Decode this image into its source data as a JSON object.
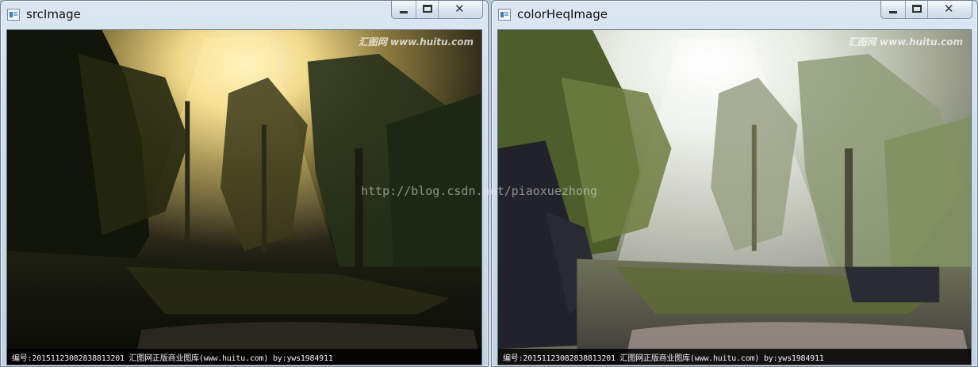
{
  "windows": [
    {
      "title": "srcImage",
      "watermark_top": "汇图网 www.huitu.com",
      "caption": "编号:20151123082838813201  汇图网正版商业图库(www.huitu.com) by:yws1984911"
    },
    {
      "title": "colorHeqImage",
      "watermark_top": "汇图网 www.huitu.com",
      "caption": "编号:20151123082838813201  汇图网正版商业图库(www.huitu.com) by:yws1984911"
    }
  ],
  "overlay_watermark": "http://blog.csdn.net/piaoxuezhong",
  "icons": {
    "app": "opencv-window-icon",
    "minimize": "minimize-icon",
    "maximize": "maximize-icon",
    "close": "close-icon"
  },
  "colors": {
    "titlebar": "#cfdcea",
    "frame_border": "#6f7f93"
  }
}
